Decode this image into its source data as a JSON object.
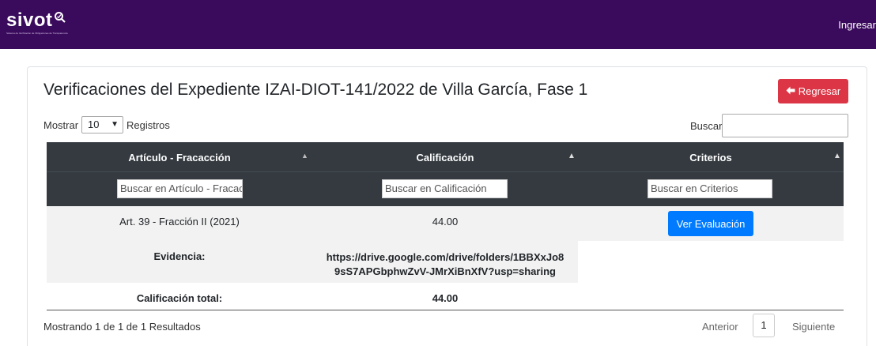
{
  "header": {
    "logo_text": "sivot",
    "logo_subtitle": "Sistema de Verificación de Obligaciones de Transparencia",
    "login_label": "Ingresar"
  },
  "page": {
    "title": "Verificaciones del Expediente IZAI-DIOT-141/2022 de Villa García, Fase 1",
    "back_button": "Regresar"
  },
  "controls": {
    "show_label": "Mostrar",
    "page_size": "10",
    "records_label": "Registros",
    "search_label": "Buscar:",
    "search_value": ""
  },
  "table": {
    "columns": [
      "Artículo - Fracacción",
      "Calificación",
      "Criterios"
    ],
    "filter_placeholders": [
      "Buscar en Artículo - Fracacción",
      "Buscar en Calificación",
      "Buscar en Criterios"
    ],
    "rows": [
      {
        "articulo": "Art. 39 - Fracción II (2021)",
        "calificacion": "44.00",
        "action": "Ver Evaluación"
      }
    ],
    "evidence_label": "Evidencia:",
    "evidence_line1": "https://drive.google.com/drive/folders/1BBXxJo8",
    "evidence_line2": "9sS7APGbphwZvV-JMrXiBnXfV?usp=sharing",
    "total_label": "Calificación total:",
    "total_value": "44.00"
  },
  "footer": {
    "info": "Mostrando 1 de 1 de 1 Resultados",
    "prev": "Anterior",
    "page": "1",
    "next": "Siguiente"
  },
  "colors": {
    "header_bg": "#3a0a5c",
    "danger": "#dc3545",
    "primary": "#007bff",
    "table_head": "#343a40"
  }
}
